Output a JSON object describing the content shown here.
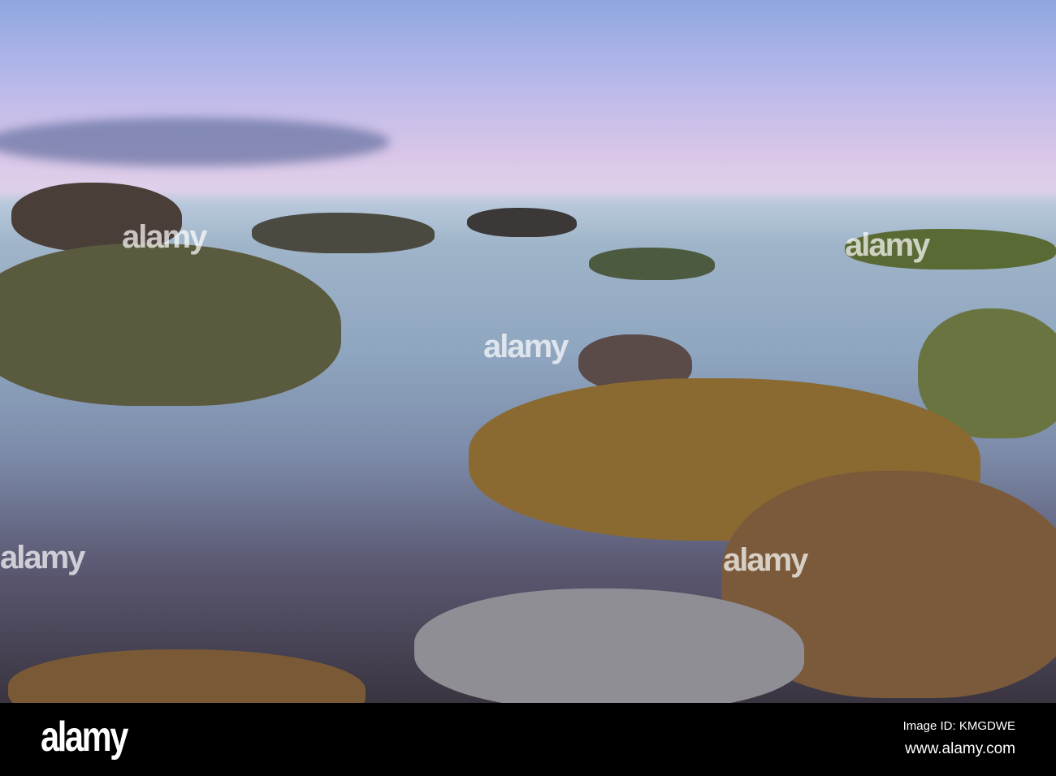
{
  "photo": {
    "subject": "long exposure rocky seashore at dusk",
    "watermark": "alamy"
  },
  "footer": {
    "logo": "alamy",
    "image_id": "Image ID: KMGDWE",
    "website": "www.alamy.com"
  }
}
